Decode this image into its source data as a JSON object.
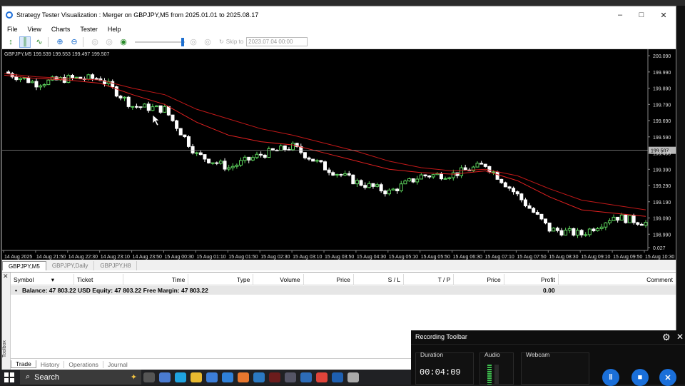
{
  "window": {
    "title": "Strategy Tester Visualization : Merger on GBPJPY,M5 from 2025.01.01 to 2025.08.17"
  },
  "menu": [
    "File",
    "View",
    "Charts",
    "Tester",
    "Help"
  ],
  "toolbar": {
    "skip_label": "Skip to",
    "skip_date": "2023.07.04 00:00",
    "speed_level": 0.98
  },
  "chart": {
    "info": "GBPJPY,M5  199.539  199.553  199.497  199.507",
    "current_price": "199.507",
    "price_ticks": [
      "200.090",
      "199.990",
      "199.890",
      "199.790",
      "199.690",
      "199.590",
      "199.490",
      "199.390",
      "199.290",
      "199.190",
      "199.090",
      "198.990",
      "0.027"
    ],
    "time_ticks": [
      "14 Aug 2025",
      "14 Aug 21:50",
      "14 Aug 22:30",
      "14 Aug 23:10",
      "14 Aug 23:50",
      "15 Aug 00:30",
      "15 Aug 01:10",
      "15 Aug 01:50",
      "15 Aug 02:30",
      "15 Aug 03:10",
      "15 Aug 03:50",
      "15 Aug 04:30",
      "15 Aug 05:10",
      "15 Aug 05:50",
      "15 Aug 06:30",
      "15 Aug 07:10",
      "15 Aug 07:50",
      "15 Aug 08:30",
      "15 Aug 09:10",
      "15 Aug 09:50",
      "15 Aug 10:30"
    ],
    "colors": {
      "bg": "#000000",
      "bull": "#5dd35d",
      "bear": "#ffffff",
      "ma_fast": "#e02020",
      "ma_slow": "#c01818"
    }
  },
  "chart_data": {
    "type": "line",
    "title": "GBPJPY,M5",
    "xlabel": "",
    "ylabel": "",
    "ylim": [
      198.89,
      200.13
    ],
    "x": [
      "14 Aug 21:10",
      "14 Aug 21:50",
      "14 Aug 22:30",
      "14 Aug 23:10",
      "14 Aug 23:50",
      "15 Aug 00:30",
      "15 Aug 01:10",
      "15 Aug 01:50",
      "15 Aug 02:30",
      "15 Aug 03:10",
      "15 Aug 03:50",
      "15 Aug 04:30",
      "15 Aug 05:10",
      "15 Aug 05:50",
      "15 Aug 06:30",
      "15 Aug 07:10",
      "15 Aug 07:50",
      "15 Aug 08:30",
      "15 Aug 09:10",
      "15 Aug 09:50",
      "15 Aug 10:30"
    ],
    "series": [
      {
        "values": [
          199.99,
          199.92,
          199.95,
          199.95,
          199.78,
          199.76,
          199.48,
          199.4,
          199.48,
          199.53,
          199.4,
          199.31,
          199.25,
          199.35,
          199.36,
          199.42,
          199.23,
          199.02,
          198.99,
          199.1,
          199.06
        ]
      },
      {
        "values": [
          199.97,
          199.95,
          199.94,
          199.92,
          199.85,
          199.79,
          199.68,
          199.6,
          199.56,
          199.54,
          199.49,
          199.44,
          199.39,
          199.37,
          199.36,
          199.38,
          199.32,
          199.22,
          199.14,
          199.12,
          199.1
        ]
      },
      {
        "values": [
          199.98,
          199.96,
          199.95,
          199.94,
          199.89,
          199.85,
          199.76,
          199.7,
          199.64,
          199.6,
          199.55,
          199.5,
          199.44,
          199.4,
          199.38,
          199.39,
          199.35,
          199.27,
          199.2,
          199.17,
          199.14
        ]
      }
    ]
  },
  "sheets": [
    "GBPJPY,M5",
    "GBPJPY,Daily",
    "GBPJPY,H8"
  ],
  "terminal": {
    "side_label": "Toolbox",
    "columns": [
      "Symbol",
      "Ticket",
      "Time",
      "Type",
      "Volume",
      "Price",
      "S / L",
      "T / P",
      "Price",
      "Profit",
      "Comment"
    ],
    "balance_row": "Balance: 47 803.22 USD  Equity: 47 803.22  Free Margin: 47 803.22",
    "profit": "0.00",
    "tabs": [
      "Trade",
      "History",
      "Operations",
      "Journal"
    ]
  },
  "taskbar": {
    "search": "Search"
  },
  "recorder": {
    "title": "Recording Toolbar",
    "duration_label": "Duration",
    "audio_label": "Audio",
    "webcam_label": "Webcam",
    "duration": "00:04:09"
  }
}
